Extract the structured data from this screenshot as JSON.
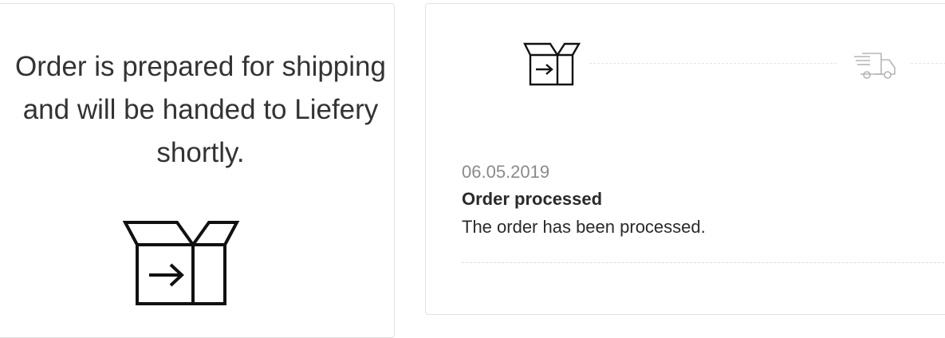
{
  "status_panel": {
    "message": "Order is prepared for shipping and will be handed to Liefery shortly.",
    "icon": "package-out-icon"
  },
  "tracking_panel": {
    "steps": [
      {
        "icon": "package-out-icon",
        "state": "active"
      },
      {
        "icon": "delivery-truck-icon",
        "state": "inactive"
      }
    ],
    "event": {
      "date": "06.05.2019",
      "title": "Order processed",
      "description": "The order has been processed."
    }
  },
  "colors": {
    "text": "#333333",
    "muted": "#8a8a8a",
    "border": "#e3e3e3",
    "inactive_icon": "#b5b5b5"
  }
}
